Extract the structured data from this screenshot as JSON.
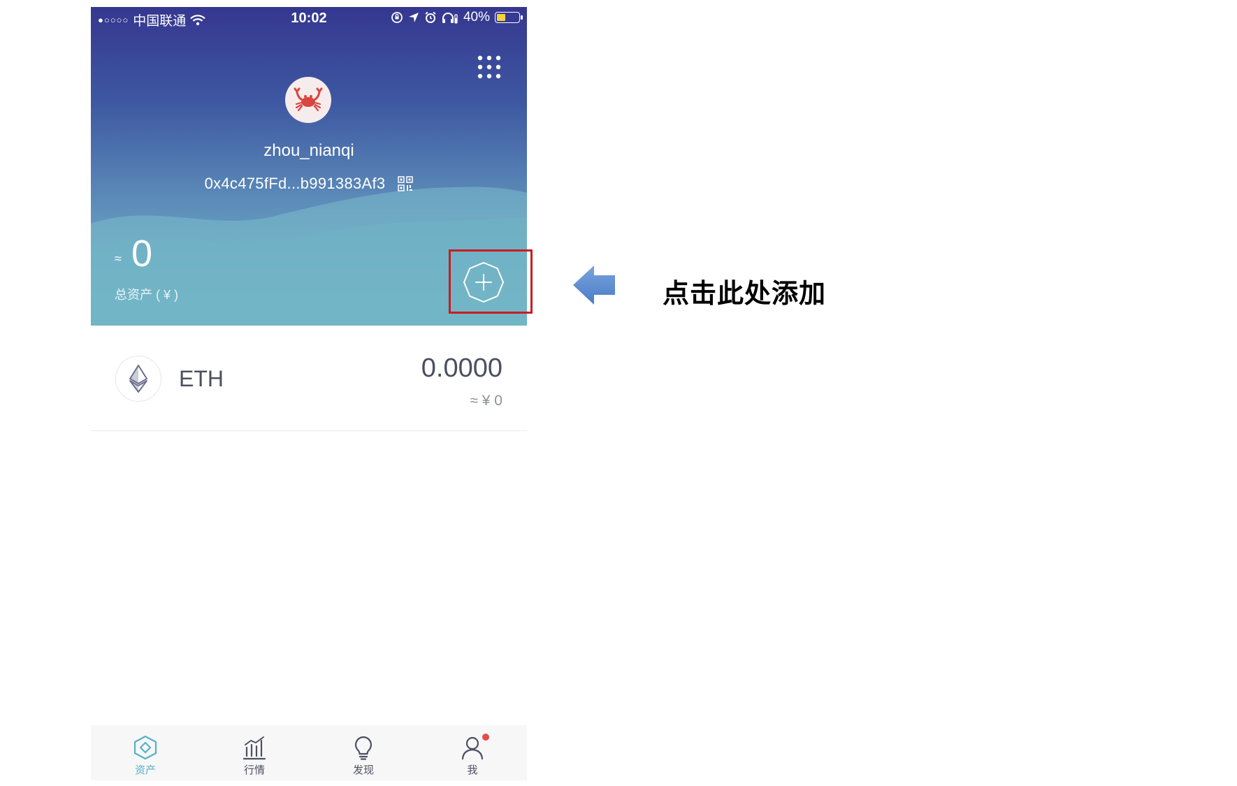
{
  "status_bar": {
    "signal": "●○○○○",
    "carrier": "中国联通",
    "time": "10:02",
    "battery_percent": "40%",
    "battery_level": 0.4
  },
  "header": {
    "menu_icon": "grid-menu-icon",
    "avatar_icon": "crab-icon",
    "username": "zhou_nianqi",
    "address": "0x4c475fFd...b991383Af3",
    "qr_icon": "qr-code-icon",
    "approx_sign": "≈",
    "total_value": "0",
    "total_label": "总资产 ( ¥ )",
    "add_icon": "add-token-icon"
  },
  "tokens": [
    {
      "symbol": "ETH",
      "icon": "ethereum-icon",
      "balance": "0.0000",
      "fiat": "≈ ¥ 0"
    }
  ],
  "annotation": {
    "text": "点击此处添加",
    "arrow_color": "#5b8bd0",
    "box_color": "#c81d21"
  },
  "tabbar": {
    "tabs": [
      {
        "label": "资产",
        "icon": "assets-icon",
        "active": true
      },
      {
        "label": "行情",
        "icon": "market-chart-icon",
        "active": false
      },
      {
        "label": "发现",
        "icon": "lightbulb-icon",
        "active": false
      },
      {
        "label": "我",
        "icon": "user-icon",
        "active": false,
        "badge": true
      }
    ]
  },
  "colors": {
    "accent": "#56b1c9",
    "header_top": "#35378f",
    "header_bottom": "#72b9c8",
    "badge": "#e44b4b"
  }
}
